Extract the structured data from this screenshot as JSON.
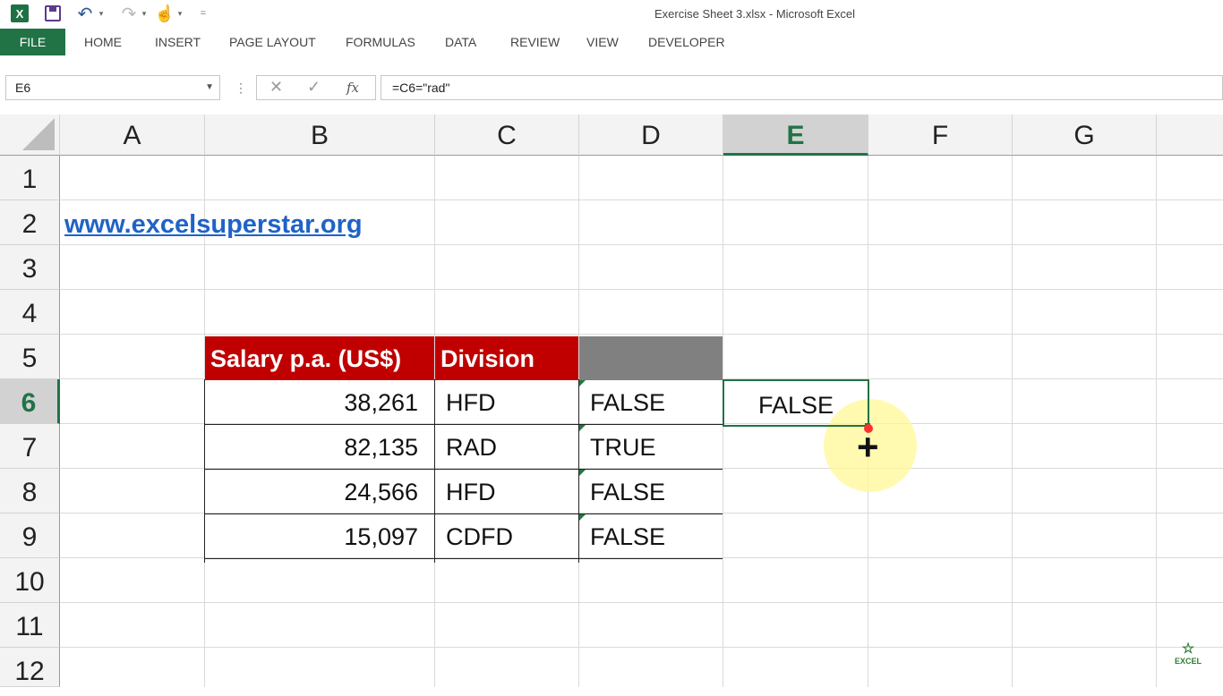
{
  "window": {
    "title": "Exercise Sheet 3.xlsx - Microsoft Excel"
  },
  "qat": {
    "excel_icon": "X",
    "undo_glyph": "↶",
    "redo_glyph": "↷",
    "touch_glyph": "☝",
    "caret": "▾",
    "customize": "="
  },
  "ribbon": {
    "tabs": [
      "FILE",
      "HOME",
      "INSERT",
      "PAGE LAYOUT",
      "FORMULAS",
      "DATA",
      "REVIEW",
      "VIEW",
      "DEVELOPER"
    ]
  },
  "formula_bar": {
    "name_box": "E6",
    "name_box_caret": "▼",
    "separator": "⋮",
    "cancel": "✕",
    "enter": "✓",
    "fx": "fx",
    "formula": "=C6=\"rad\""
  },
  "sheet": {
    "columns": [
      "A",
      "B",
      "C",
      "D",
      "E",
      "F",
      "G"
    ],
    "selected_column": "E",
    "rows": [
      "1",
      "2",
      "3",
      "4",
      "5",
      "6",
      "7",
      "8",
      "9",
      "10",
      "11",
      "12"
    ],
    "selected_row": "6",
    "link": "www.excelsuperstar.org",
    "table": {
      "headers": [
        "Salary p.a. (US$)",
        "Division",
        ""
      ],
      "rows": [
        {
          "salary": "38,261",
          "division": "HFD",
          "result": "FALSE"
        },
        {
          "salary": "82,135",
          "division": "RAD",
          "result": "TRUE"
        },
        {
          "salary": "24,566",
          "division": "HFD",
          "result": "FALSE"
        },
        {
          "salary": "15,097",
          "division": "CDFD",
          "result": "FALSE"
        }
      ]
    },
    "active_cell": {
      "ref": "E6",
      "value": "FALSE"
    }
  },
  "watermark": {
    "text": "EXCEL",
    "star": "☆"
  },
  "colors": {
    "excel_green": "#217346",
    "header_red": "#c00000",
    "header_gray": "#808080",
    "link_blue": "#1f63c6"
  }
}
